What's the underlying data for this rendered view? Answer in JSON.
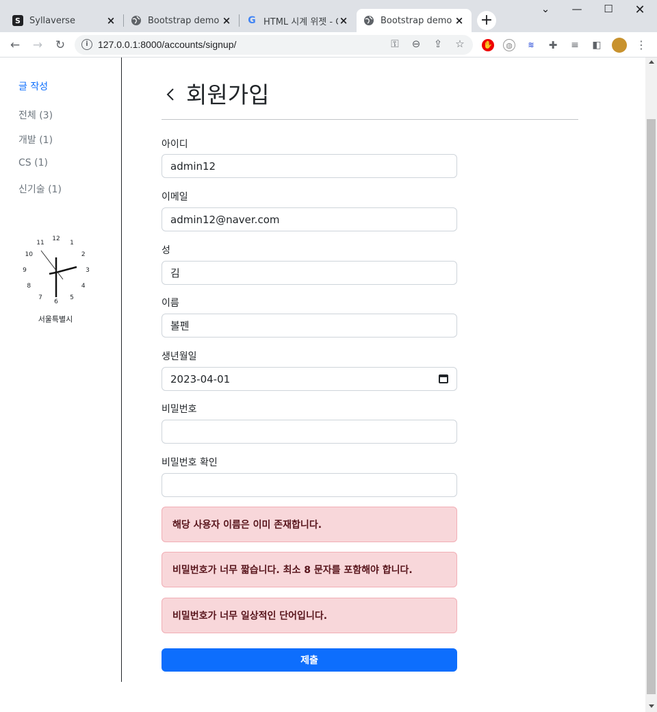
{
  "browser": {
    "tabs": [
      {
        "title": "Syllaverse",
        "favicon": "S"
      },
      {
        "title": "Bootstrap demo",
        "favicon": "globe-icon"
      },
      {
        "title": "HTML 시계 위젯 - G",
        "favicon": "G"
      },
      {
        "title": "Bootstrap demo",
        "favicon": "globe-icon"
      }
    ],
    "url": "127.0.0.1:8000/accounts/signup/"
  },
  "sidebar": {
    "write_link": "글 작성",
    "categories": [
      "전체 (3)",
      "개발 (1)",
      "CS (1)",
      "신기술 (1)"
    ],
    "clock": {
      "numbers": [
        "12",
        "1",
        "2",
        "3",
        "4",
        "5",
        "6",
        "7",
        "8",
        "9",
        "10",
        "11"
      ],
      "city": "서울특별시"
    }
  },
  "form": {
    "title": "회원가입",
    "fields": [
      {
        "label": "아이디",
        "value": "admin12"
      },
      {
        "label": "이메일",
        "value": "admin12@naver.com"
      },
      {
        "label": "성",
        "value": "김"
      },
      {
        "label": "이름",
        "value": "볼펜"
      },
      {
        "label": "생년월일",
        "value": "2023-04-01"
      },
      {
        "label": "비밀번호",
        "value": ""
      },
      {
        "label": "비밀번호 확인",
        "value": ""
      }
    ],
    "errors": [
      "해당 사용자 이름은 이미 존재합니다.",
      "비밀번호가 너무 짧습니다. 최소 8 문자를 포함해야 합니다.",
      "비밀번호가 너무 일상적인 단어입니다."
    ],
    "submit_label": "제출"
  },
  "colors": {
    "primary": "#0d6efd",
    "alert_bg": "#f8d7da",
    "alert_text": "#58151c"
  }
}
